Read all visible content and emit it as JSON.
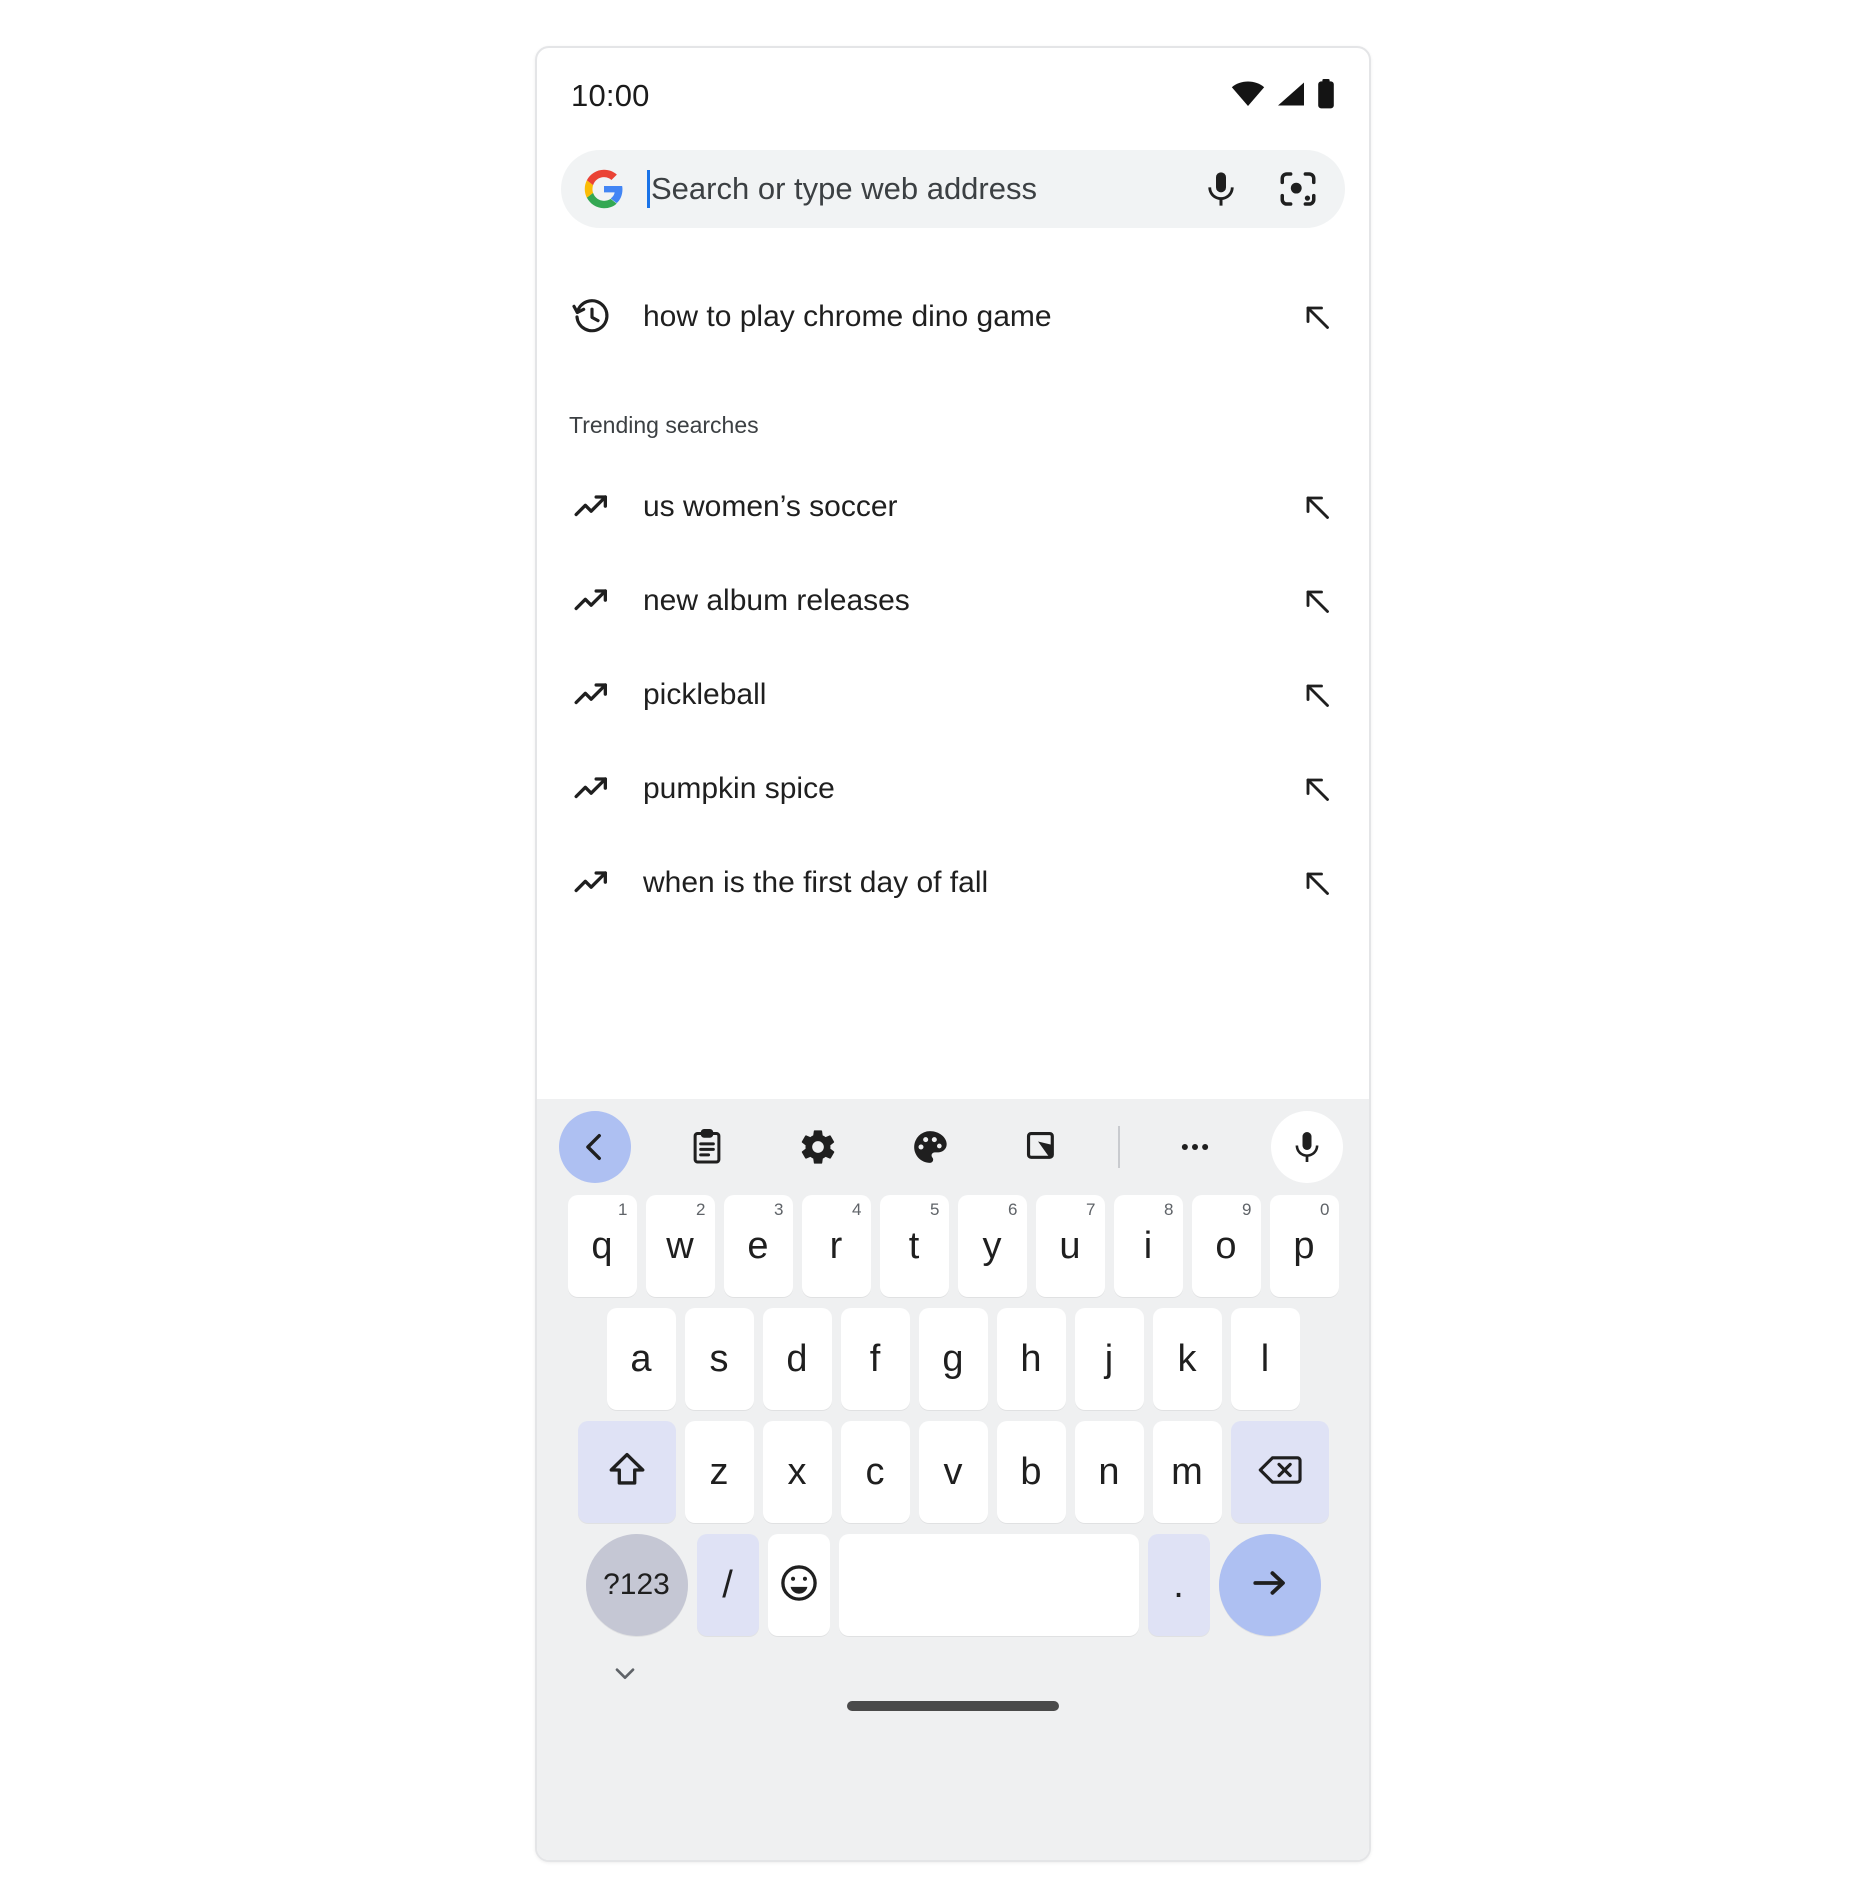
{
  "status_bar": {
    "time": "10:00",
    "icons": [
      "wifi-icon",
      "cell-signal-icon",
      "battery-icon"
    ]
  },
  "omnibox": {
    "brand_icon": "google-g-icon",
    "placeholder": "Search or type web address",
    "value": "",
    "caret_color": "#1a73e8",
    "background": "#f1f3f4",
    "voice_icon": "microphone-icon",
    "lens_icon": "google-lens-icon"
  },
  "suggestions": {
    "history": [
      {
        "icon": "history-clock-icon",
        "label": "how to play chrome dino game",
        "append_icon": "arrow-northwest-icon"
      }
    ],
    "trending_header": "Trending searches",
    "trending": [
      {
        "icon": "trending-up-icon",
        "label": "us women’s soccer",
        "append_icon": "arrow-northwest-icon"
      },
      {
        "icon": "trending-up-icon",
        "label": "new album releases",
        "append_icon": "arrow-northwest-icon"
      },
      {
        "icon": "trending-up-icon",
        "label": "pickleball",
        "append_icon": "arrow-northwest-icon"
      },
      {
        "icon": "trending-up-icon",
        "label": "pumpkin spice",
        "append_icon": "arrow-northwest-icon"
      },
      {
        "icon": "trending-up-icon",
        "label": "when is the first day of fall",
        "append_icon": "arrow-northwest-icon"
      }
    ]
  },
  "keyboard": {
    "background": "#eff0f1",
    "accent_color": "#aec0f2",
    "function_key_color": "#dfe2f5",
    "symbol_key_color": "#c5c7d4",
    "toolbar": [
      {
        "name": "back-chevron-icon",
        "style": "accent"
      },
      {
        "name": "clipboard-icon",
        "style": "plain"
      },
      {
        "name": "gear-icon",
        "style": "plain"
      },
      {
        "name": "palette-icon",
        "style": "plain"
      },
      {
        "name": "one-handed-mode-icon",
        "style": "plain"
      },
      {
        "name": "toolbar-divider",
        "style": "divider"
      },
      {
        "name": "overflow-dots-icon",
        "style": "plain"
      },
      {
        "name": "microphone-icon",
        "style": "mic-white"
      }
    ],
    "row1": [
      {
        "key": "q",
        "digit": "1"
      },
      {
        "key": "w",
        "digit": "2"
      },
      {
        "key": "e",
        "digit": "3"
      },
      {
        "key": "r",
        "digit": "4"
      },
      {
        "key": "t",
        "digit": "5"
      },
      {
        "key": "y",
        "digit": "6"
      },
      {
        "key": "u",
        "digit": "7"
      },
      {
        "key": "i",
        "digit": "8"
      },
      {
        "key": "o",
        "digit": "9"
      },
      {
        "key": "p",
        "digit": "0"
      }
    ],
    "row2": [
      "a",
      "s",
      "d",
      "f",
      "g",
      "h",
      "j",
      "k",
      "l"
    ],
    "row3": {
      "shift_label": "shift-icon",
      "keys": [
        "z",
        "x",
        "c",
        "v",
        "b",
        "n",
        "m"
      ],
      "backspace_label": "backspace-icon"
    },
    "row4": {
      "symbols_label": "?123",
      "slash_label": "/",
      "emoji_label": "emoji-icon",
      "space_label": "",
      "period_label": ".",
      "enter_label": "enter-arrow-icon"
    },
    "hide_keyboard_icon": "chevron-down-icon",
    "home_indicator": "gesture-home-bar"
  }
}
